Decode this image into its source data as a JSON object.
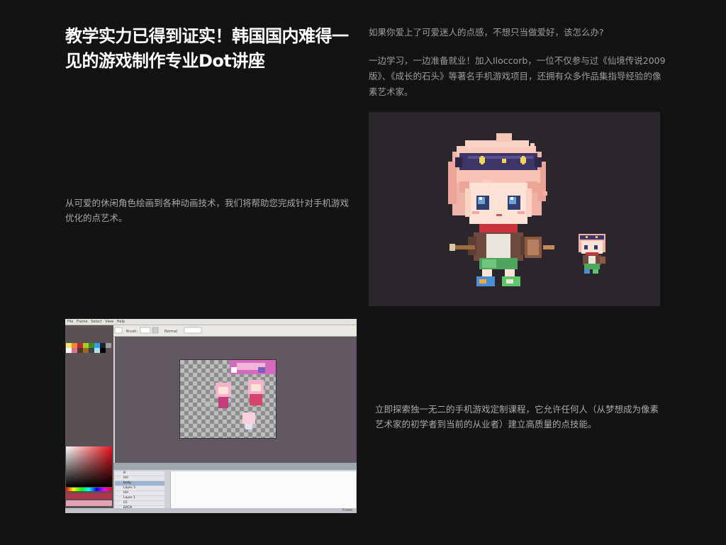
{
  "headline": "教学实力已得到证实！韩国国内难得一见的游戏制作专业Dot讲座",
  "intro": {
    "question": "如果你爱上了可爱迷人的点感，不想只当做爱好，该怎么办?",
    "body": "一边学习，一边准备就业！加入Iloccorb，一位不仅参与过《仙境传说2009版》、《成长的石头》等著名手机游戏项目，还拥有众多作品集指导经验的像素艺术家。"
  },
  "body_left": "从可爱的休闲角色绘画到各种动画技术，我们将帮助您完成针对手机游戏优化的点艺术。",
  "body_right": "立即探索独一无二的手机游戏定制课程，它允许任何人（从梦想成为像素艺术家的初学者到当前的从业者）建立高质量的点技能。",
  "editor": {
    "menu": [
      "File",
      "Frame",
      "Select",
      "View",
      "Help"
    ],
    "brush_label": "Brush:",
    "brush_value": "1px",
    "mode_label": "Normal",
    "layers": [
      "B",
      "HH",
      "body",
      "Layer 3",
      "HH",
      "Layer 1",
      "CE",
      "BACK"
    ],
    "status": "Frame"
  },
  "colors": {
    "background": "#131313",
    "headline": "#ffffff",
    "body_text": "#a8a8a8",
    "art_background": "#2a262b"
  }
}
